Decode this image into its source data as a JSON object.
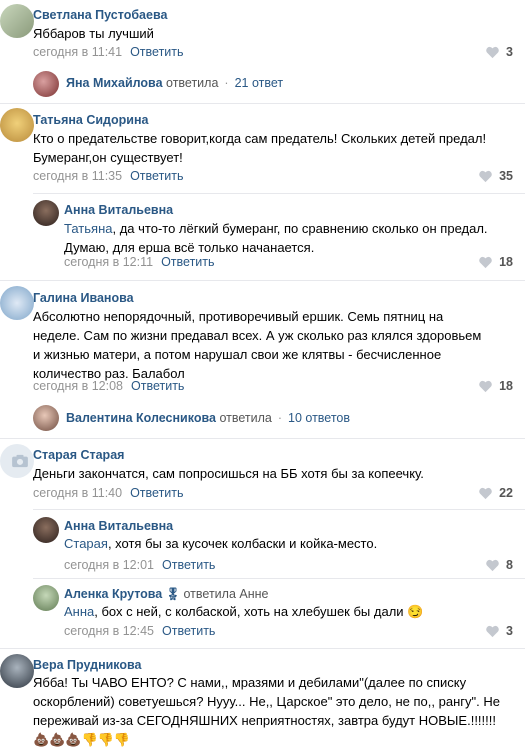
{
  "comments": [
    {
      "name": "Светлана Пустобаева",
      "text": "Яббаров ты лучший",
      "time": "сегодня в 11:41",
      "reply": "Ответить",
      "likes": "3"
    },
    {
      "thread": {
        "name": "Яна Михайлова",
        "action": "ответила",
        "count": "21 ответ"
      }
    },
    {
      "name": "Татьяна Сидорина",
      "text": "Кто о предательстве говорит,когда сам предатель! Скольких детей предал! Бумеранг,он существует!",
      "time": "сегодня в 11:35",
      "reply": "Ответить",
      "likes": "35"
    },
    {
      "name": "Анна Витальевна",
      "mention": "Татьяна",
      "text": ", да что-то лёгкий бумеранг, по сравнению сколько он предал. Думаю, для ерша всё только начанается.",
      "time": "сегодня в 12:11",
      "reply": "Ответить",
      "likes": "18"
    },
    {
      "name": "Галина Иванова",
      "text": "Абсолютно непорядочный, противоречивый ершик. Семь пятниц на неделе. Сам по жизни предавал всех. А уж сколько раз клялся здоровьем и жизнью матери, а потом нарушал свои же клятвы - бесчисленное количество раз. Балабол",
      "time": "сегодня в 12:08",
      "reply": "Ответить",
      "likes": "18"
    },
    {
      "thread": {
        "name": "Валентина Колесникова",
        "action": "ответила",
        "count": "10 ответов"
      }
    },
    {
      "name": "Старая Старая",
      "text": "Деньги закончатся, сам попросишься на ББ хотя бы за копеечку.",
      "time": "сегодня в 11:40",
      "reply": "Ответить",
      "likes": "22"
    },
    {
      "name": "Анна Витальевна",
      "mention": "Старая",
      "text": ", хотя бы за кусочек колбаски и койка-место.",
      "time": "сегодня в 12:01",
      "reply": "Ответить",
      "likes": "8"
    },
    {
      "name": "Аленка Крутова",
      "badge": "ответила Анне",
      "mention": "Анна",
      "text": ", бох с ней, с колбаской, хоть на хлебушек бы дали 😏",
      "time": "сегодня в 12:45",
      "reply": "Ответить",
      "likes": "3"
    },
    {
      "name": "Вера Прудникова",
      "text": "Ябба! Ты ЧАВО ЕНТО? С нами,, мразями и дебилами\"(далее по списку оскорблений) советуешься? Нууу... Не,, Царское\" это дело, не по,, рангу\". Не переживай из-за СЕГОДНЯШНИХ неприятностях, завтра будут НОВЫЕ.!!!!!!! 💩💩💩👎👎👎"
    }
  ],
  "colors": {
    "link": "#2a5885",
    "meta": "#939393",
    "divider": "#e7e8ec"
  },
  "icons": {
    "like": "heart-icon",
    "camera": "camera-icon"
  }
}
